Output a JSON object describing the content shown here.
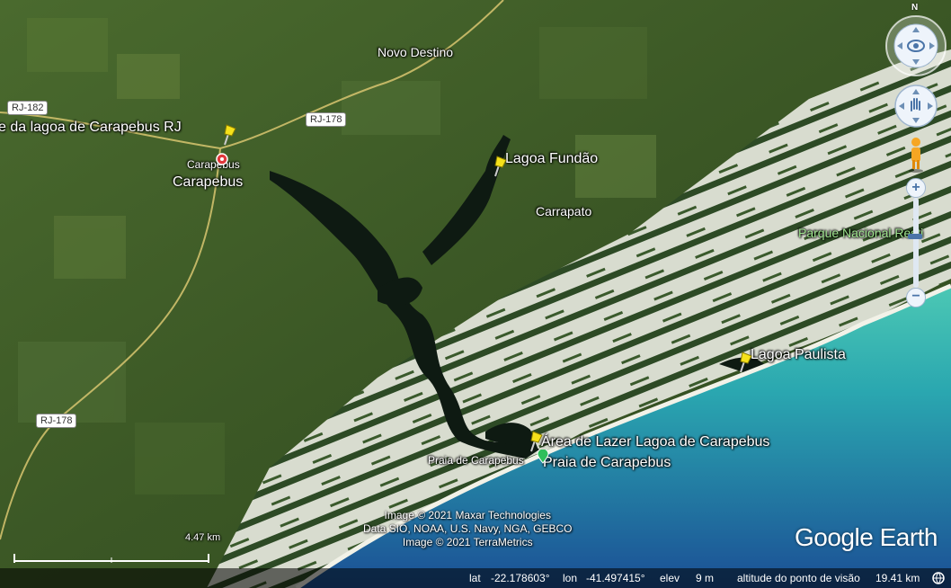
{
  "places": {
    "novo_destino": "Novo Destino",
    "carapebus_small": "Carapebus",
    "carapebus_big": "Carapebus",
    "carrapato": "Carrapato",
    "lagoa_fundao": "Lagoa Fundão",
    "lagoa_paulista": "Lagoa Paulista",
    "lagoa_rj": "e da lagoa de Carapebus RJ",
    "area_lazer": "Área de Lazer Lagoa de Carapebus",
    "praia_small": "Praia de Carapebus",
    "praia_big": "Praia de Carapebus",
    "parque": "Parque Nacional Resti"
  },
  "roads": {
    "rj182": "RJ-182",
    "rj178_top": "RJ-178",
    "rj178_bottom": "RJ-178"
  },
  "scale": {
    "label": "4.47 km"
  },
  "credits": {
    "line1": "Image © 2021 Maxar Technologies",
    "line2": "Data SIO, NOAA, U.S. Navy, NGA, GEBCO",
    "line3": "Image © 2021 TerraMetrics"
  },
  "brand": "Google Earth",
  "compass": {
    "north": "N"
  },
  "zoom": {
    "plus": "+",
    "minus": "−"
  },
  "status": {
    "lat_label": "lat",
    "lat_value": "-22.178603°",
    "lon_label": "lon",
    "lon_value": "-41.497415°",
    "elev_label": "elev",
    "elev_value": "9 m",
    "alt_label": "altitude do ponto de visão",
    "alt_value": "19.41 km"
  },
  "colors": {
    "land": "#3e5a28",
    "water_dark": "#0f1a12",
    "sand": "#d9ddd2",
    "ocean_shallow": "#3fbfb0",
    "ocean_deep": "#1f5fa0",
    "pin_yellow": "#f5e11a",
    "marker_red": "#e0383b",
    "marker_green": "#2fbf5b"
  }
}
